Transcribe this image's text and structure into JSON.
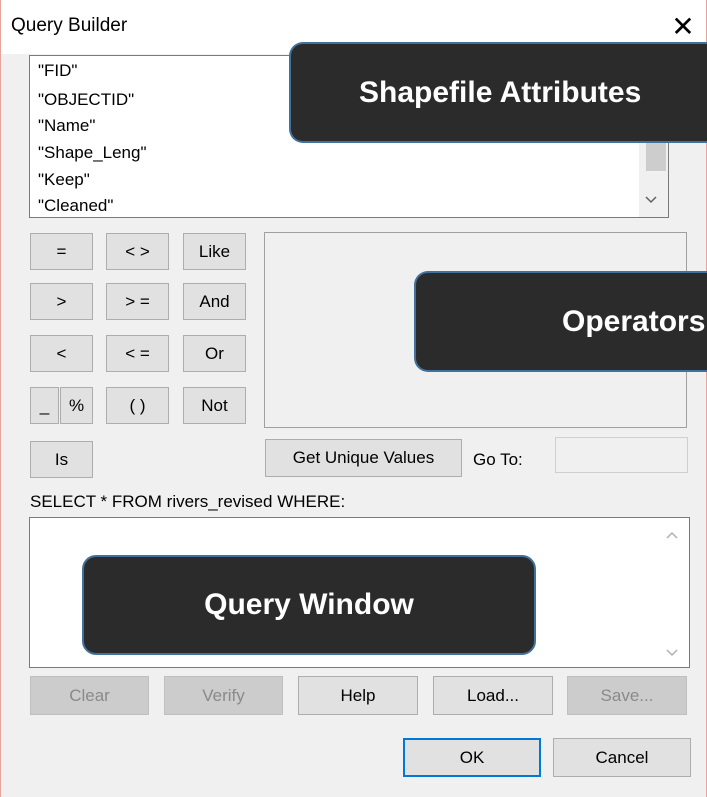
{
  "window": {
    "title": "Query Builder",
    "close_glyph": "✕"
  },
  "attributes": [
    "\"FID\"",
    "\"OBJECTID\"",
    "\"Name\"",
    "\"Shape_Leng\"",
    "\"Keep\"",
    "\"Cleaned\""
  ],
  "operators": {
    "eq": "=",
    "neq": "< >",
    "like": "Like",
    "gt": ">",
    "gte": "> =",
    "and": "And",
    "lt": "<",
    "lte": "< =",
    "or": "Or",
    "underscore": "_",
    "percent": "%",
    "parens": "( )",
    "not": "Not",
    "is": "Is"
  },
  "get_unique_values": "Get Unique Values",
  "goto_label": "Go To:",
  "goto_value": "",
  "select_clause": "SELECT * FROM rivers_revised WHERE:",
  "query_text": "",
  "buttons": {
    "clear": "Clear",
    "verify": "Verify",
    "help": "Help",
    "load": "Load...",
    "save": "Save...",
    "ok": "OK",
    "cancel": "Cancel"
  },
  "annotations": {
    "shapefile": "Shapefile Attributes",
    "operators": "Operators",
    "query_window": "Query Window"
  },
  "icons": {
    "scroll_down": "chevron-down-icon",
    "scroll_up": "chevron-up-icon"
  }
}
